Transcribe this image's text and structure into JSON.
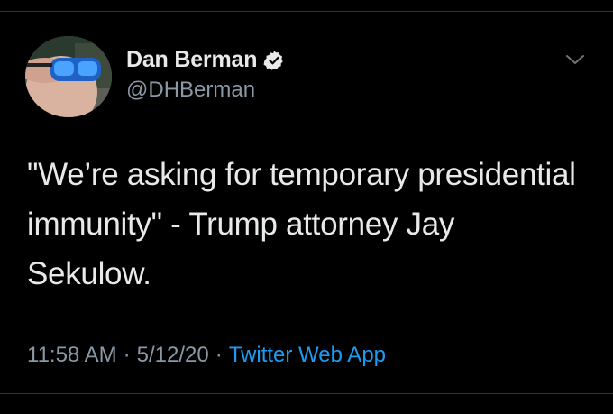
{
  "author": {
    "display_name": "Dan Berman",
    "handle": "@DHBerman",
    "verified": true
  },
  "tweet": {
    "text": "\"We’re asking for temporary presidential immunity\" - Trump attorney Jay Sekulow.",
    "time": "11:58 AM",
    "separator": "·",
    "date": "5/12/20",
    "source": "Twitter Web App"
  },
  "icons": {
    "verified": "verified-badge-icon",
    "more": "chevron-down-icon"
  },
  "colors": {
    "background": "#000000",
    "primary_text": "#e7e9ea",
    "secondary_text": "#8b98a5",
    "link": "#1d9bf0",
    "border": "#2f3336"
  }
}
